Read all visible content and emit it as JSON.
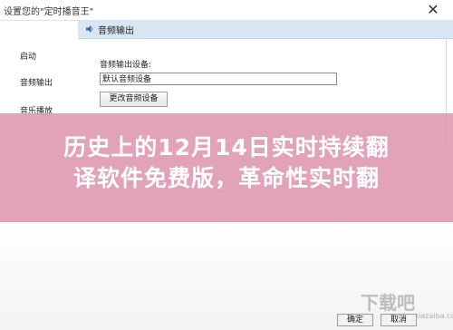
{
  "window": {
    "title": "设置您的\"定时播音王\"",
    "close_glyph": "✕"
  },
  "sidebar": {
    "items": [
      {
        "label": "启动"
      },
      {
        "label": "音频输出"
      },
      {
        "label": "音乐播放"
      }
    ]
  },
  "panel": {
    "heading": "音频输出",
    "device_label": "音频输出设备:",
    "device_value": "默认音频设备",
    "change_button": "更改音频设备"
  },
  "dialog_buttons": {
    "ok": "确定",
    "cancel": "取消"
  },
  "overlay": {
    "headline_line1": "历史上的12月14日实时持续翻",
    "headline_line2": "译软件免费版，革命性实时翻"
  },
  "watermark": {
    "top": "下载吧",
    "bottom": "www.xiazaiba.com"
  },
  "colors": {
    "overlay": "#df9bb2",
    "panel_header": "#d8e6f3"
  }
}
